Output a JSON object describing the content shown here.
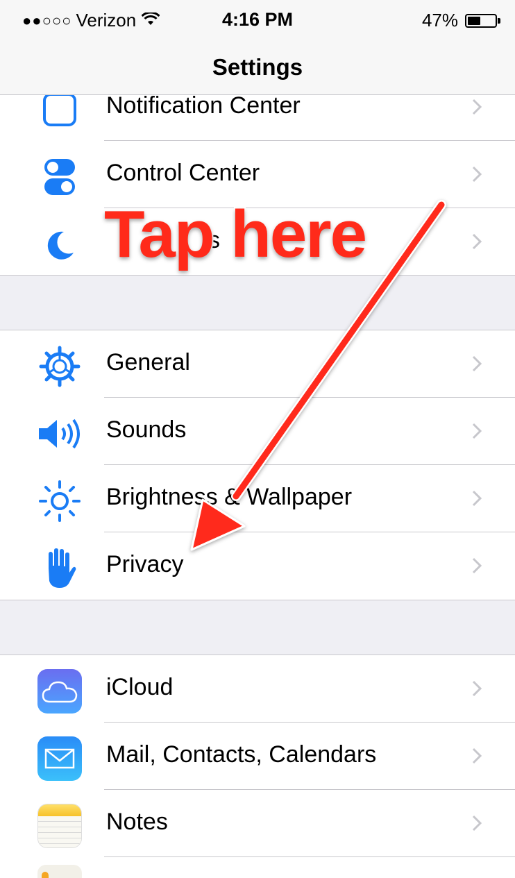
{
  "status_bar": {
    "signal_dots": "●●○○○",
    "carrier": "Verizon",
    "wifi_glyph": "ᯤ",
    "time": "4:16 PM",
    "battery_percent": "47%",
    "battery_level": 0.47
  },
  "nav": {
    "title": "Settings"
  },
  "rows": {
    "notification_center": "Notification Center",
    "control_center": "Control Center",
    "do_not_disturb_partial": "s",
    "general": "General",
    "sounds": "Sounds",
    "brightness": "Brightness & Wallpaper",
    "privacy": "Privacy",
    "icloud": "iCloud",
    "mail": "Mail, Contacts, Calendars",
    "notes": "Notes"
  },
  "annotation": {
    "text": "Tap here",
    "color": "#ff2a1a"
  },
  "colors": {
    "ios_blue": "#1a7cf5",
    "chevron": "#c7c7cc",
    "separator": "#c8c7cc",
    "group_bg": "#efeff4"
  },
  "icons": {
    "notification_center": "notification-center-icon",
    "control_center": "toggle-switches-icon",
    "do_not_disturb": "moon-icon",
    "general": "gear-icon",
    "sounds": "speaker-icon",
    "brightness": "sun-icon",
    "privacy": "hand-icon",
    "icloud": "cloud-icon",
    "mail": "envelope-icon",
    "notes": "notes-icon"
  }
}
